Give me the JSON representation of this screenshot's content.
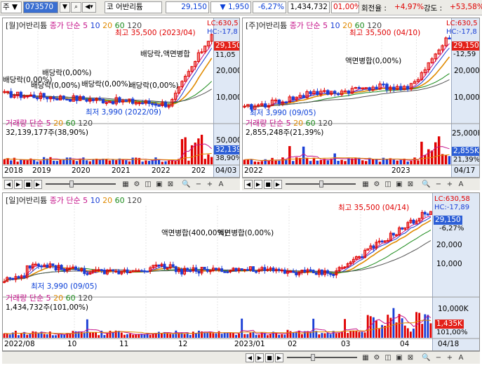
{
  "toolbar": {
    "label": "주",
    "code": "073570",
    "code_type": "코",
    "name": "어반리튬",
    "price": "29,150",
    "change_arrow": "▼",
    "change": "1,950",
    "change_pct": "-6,27%",
    "volume": "1,434,732",
    "vol_pct": "01,00%",
    "turnover_label": "회전율 :",
    "turnover": "+4,97%",
    "strength_label": "강도 :",
    "strength": "+53,58%"
  },
  "panels": {
    "monthly": {
      "period": "[월]",
      "name": "어반리튬",
      "title_rest": "종가 단순",
      "ma": [
        "5",
        "10",
        "20",
        "60",
        "120"
      ],
      "lc": "LC:630,5",
      "hc": "HC:-17,8",
      "high": "최고 35,500 (2023/04)",
      "low": "최저 3,990 (2022/09)",
      "price_box": "29,150",
      "pct_label": "11,05",
      "y_labels": [
        "20,000",
        "10,000"
      ],
      "notes": [
        "배당락,액면병합",
        "배당락(0,00%)",
        "배당락(0,00%)",
        "배당락(0,00%)",
        "배당락(0,00%)",
        "배당락(0,00%)"
      ],
      "vol_title": "거래량 단순",
      "vol_ma": [
        "5",
        "20",
        "60",
        "120"
      ],
      "vol_value": "32,139,177주(38,90%)",
      "vol_y": "50,000",
      "vol_box": "32,139",
      "vol_pct": "38,90%",
      "x_labels": [
        "2018",
        "2019",
        "2020",
        "2021",
        "2022",
        "202"
      ],
      "date": "04/03"
    },
    "weekly": {
      "period": "[주]",
      "name": "어반리튬",
      "title_rest": "종가 단순",
      "ma": [
        "5",
        "10",
        "20",
        "60",
        "120"
      ],
      "lc": "LC:630,5",
      "hc": "HC:-17,8",
      "high": "최고 35,500 (04/10)",
      "low": "최저 3,990 (09/05)",
      "price_box": "29,150",
      "pct_label": "-12,59",
      "y_labels": [
        "20,000",
        "10,000"
      ],
      "notes": [
        "액면병합(0,00%)"
      ],
      "vol_title": "거래량 단순",
      "vol_ma": [
        "5",
        "20",
        "60",
        "120"
      ],
      "vol_value": "2,855,248주(21,39%)",
      "vol_y": "25,000K",
      "vol_box": "2,855K",
      "vol_pct": "21,39%",
      "x_labels": [
        "2022",
        "2023"
      ],
      "date": "04/17"
    },
    "daily": {
      "period": "[일]",
      "name": "어반리튬",
      "title_rest": "종가 단순",
      "ma": [
        "5",
        "10",
        "20",
        "60",
        "120"
      ],
      "lc": "LC:630,58",
      "hc": "HC:-17,89",
      "high": "최고 35,500 (04/14)",
      "low": "최저 3,990 (09/05)",
      "price_box": "29,150",
      "pct_label": "-6,27%",
      "y_labels": [
        "20,000",
        "10,000"
      ],
      "notes": [
        "액면병합(400,00%)",
        "액면병합(0,00%)"
      ],
      "vol_title": "거래량 단순",
      "vol_ma": [
        "5",
        "20",
        "60",
        "120"
      ],
      "vol_value": "1,434,732주(101,00%)",
      "vol_y": "10,000K",
      "vol_box": "1,435K",
      "vol_pct": "101,00%",
      "x_labels": [
        "2022/08",
        "10",
        "11",
        "12",
        "2023/01",
        "02",
        "03",
        "04"
      ],
      "date": "04/18"
    }
  },
  "controls": {
    "left": "◀",
    "right": "▶",
    "stop": "■",
    "play": "▶",
    "minus": "−",
    "plus": "+",
    "a": "A"
  },
  "colors": {
    "up": "#e00000",
    "down": "#1a3fd6",
    "ma5": "#c5138a",
    "ma10": "#1a3fd6",
    "ma20": "#e08a00",
    "ma60": "#1a8a1a",
    "ma120": "#555555",
    "scale_bg": "#dfe8f5"
  }
}
